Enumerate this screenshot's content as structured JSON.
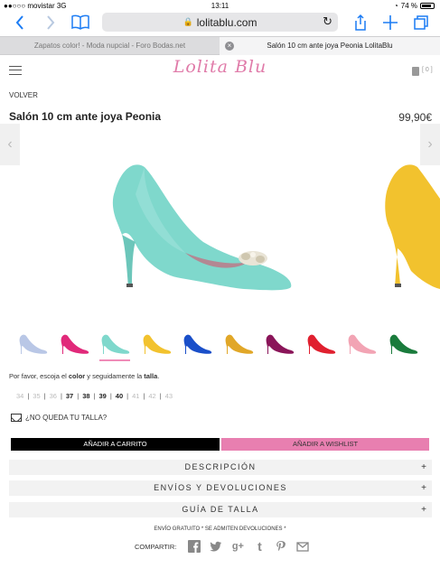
{
  "status_bar": {
    "carrier": "●●○○○ movistar  3G",
    "time": "13:11",
    "battery_pct": "74 %"
  },
  "toolbar": {
    "url": "lolitablu.com",
    "back_icon": "chevron-left-icon",
    "forward_icon": "chevron-right-icon",
    "bookmarks_icon": "book-icon",
    "share_icon": "share-icon",
    "new_tab_icon": "plus-icon",
    "tabs_icon": "tabs-icon"
  },
  "tabs": [
    {
      "title": "Zapatos color! - Moda nupcial - Foro Bodas.net"
    },
    {
      "title": "Salón 10 cm ante joya Peonia LolitaBlu"
    }
  ],
  "site": {
    "logo": "Lolita Blu",
    "cart_count": "[ 0 ]"
  },
  "product": {
    "back": "VOLVER",
    "title": "Salón 10 cm ante joya Peonia",
    "price": "99,90€",
    "main_color": "#7fd8cc",
    "thumbs": [
      {
        "color": "#b9c7e6"
      },
      {
        "color": "#e1297a"
      },
      {
        "color": "#7fd8cc"
      },
      {
        "color": "#f2c22e"
      },
      {
        "color": "#1a4fc9"
      },
      {
        "color": "#e1a728"
      },
      {
        "color": "#8a1559"
      },
      {
        "color": "#e0202f"
      },
      {
        "color": "#f2a4b4"
      },
      {
        "color": "#1a7b3c"
      }
    ],
    "choose_pre": "Por favor, escoja el ",
    "choose_color": "color",
    "choose_mid": " y seguidamente la ",
    "choose_size": "talla",
    "choose_end": ".",
    "sizes": [
      {
        "label": "34",
        "available": false
      },
      {
        "label": "35",
        "available": false
      },
      {
        "label": "36",
        "available": false
      },
      {
        "label": "37",
        "available": true
      },
      {
        "label": "38",
        "available": true
      },
      {
        "label": "39",
        "available": true
      },
      {
        "label": "40",
        "available": true
      },
      {
        "label": "41",
        "available": false
      },
      {
        "label": "42",
        "available": false
      },
      {
        "label": "43",
        "available": false
      }
    ],
    "no_size": "¿NO QUEDA TU TALLA?",
    "add_cart": "AÑADIR A CARRITO",
    "add_wishlist": "AÑADIR A WISHLIST",
    "accordion": [
      {
        "label": "DESCRIPCIÓN"
      },
      {
        "label": "ENVÍOS Y DEVOLUCIONES"
      },
      {
        "label": "GUÍA DE TALLA"
      }
    ],
    "ship_note": "ENVÍO GRATUITO *  SE ADMITEN DEVOLUCIONES *",
    "share_label": "COMPARTIR:",
    "share_icons": [
      "facebook-icon",
      "twitter-icon",
      "google-plus-icon",
      "tumblr-icon",
      "pinterest-icon",
      "email-icon"
    ]
  }
}
